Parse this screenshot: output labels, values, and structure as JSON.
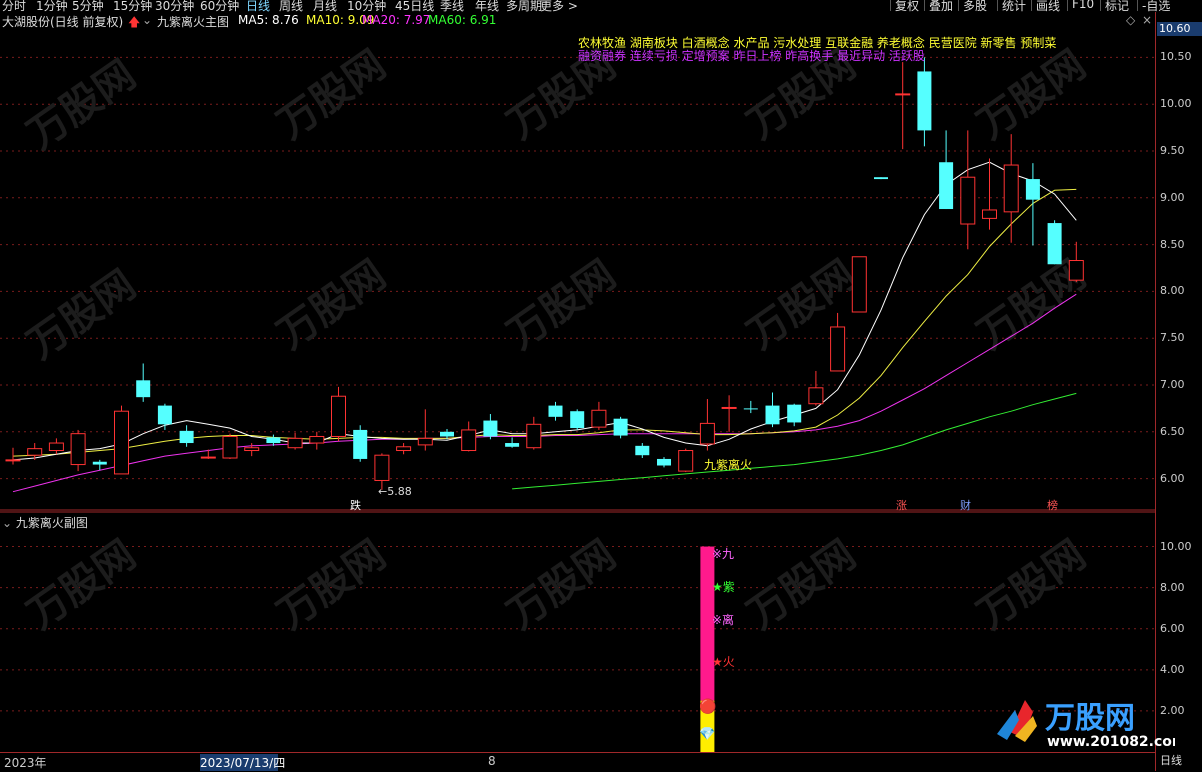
{
  "periods": [
    "分时",
    "1分钟",
    "5分钟",
    "15分钟",
    "30分钟",
    "60分钟",
    "日线",
    "周线",
    "月线",
    "10分钟",
    "45日线",
    "季线",
    "年线",
    "多周期",
    "更多 >"
  ],
  "active_period": "日线",
  "toolbar_right": [
    "复权",
    "叠加",
    "多股",
    "统计",
    "画线",
    "F10",
    "标记",
    "-自选"
  ],
  "stock_title": "大湖股份(日线 前复权)",
  "indicator_name": "九紫离火主图",
  "ma": [
    {
      "label": "MA5: 8.76",
      "color": "#ffffff"
    },
    {
      "label": "MA10: 9.09",
      "color": "#ffff33"
    },
    {
      "label": "MA20: 7.97",
      "color": "#ff33ff"
    },
    {
      "label": "MA60: 6.91",
      "color": "#33ff33"
    }
  ],
  "concepts_line1": "农林牧渔  湖南板块  白酒概念 水产品 污水处理 互联金融 养老概念 民营医院 新零售 预制菜",
  "concepts_line2": "融资融券 连续亏损 定增预案 昨日上榜 昨高换手 最近异动 活跃股",
  "current_price": "10.60",
  "price_ticks": [
    "10.50",
    "10.00",
    "9.50",
    "9.00",
    "8.50",
    "8.00",
    "7.50",
    "7.00",
    "6.50",
    "6.00"
  ],
  "sub_ticks": [
    "10.00",
    "8.00",
    "6.00",
    "4.00",
    "2.00"
  ],
  "low_label": "←5.88",
  "signal_label": "九紫离火",
  "markers": [
    {
      "text": "跌",
      "color": "#ffffff"
    },
    {
      "text": "涨",
      "color": "#ff5555"
    },
    {
      "text": "财",
      "color": "#7f9fff"
    },
    {
      "text": "榜",
      "color": "#ff5555"
    }
  ],
  "sub_panel_title": "九紫离火副图",
  "sub_signals": [
    {
      "text": "※九",
      "color": "#ff66ff"
    },
    {
      "text": "★紫",
      "color": "#33ff33"
    },
    {
      "text": "※离",
      "color": "#ff66ff"
    },
    {
      "text": "★火",
      "color": "#ff3333"
    }
  ],
  "bottom_year": "2023年",
  "bottom_date": "2023/07/13/四",
  "bottom_month": "8",
  "bottom_right": "日线",
  "watermark_brand": "万股网",
  "watermark_url": "www.201082.com",
  "chart_data": {
    "type": "candlestick",
    "ylim": [
      5.75,
      10.75
    ],
    "candles": [
      {
        "o": 6.19,
        "h": 6.33,
        "l": 6.15,
        "c": 6.2
      },
      {
        "o": 6.25,
        "h": 6.38,
        "l": 6.2,
        "c": 6.32
      },
      {
        "o": 6.3,
        "h": 6.43,
        "l": 6.26,
        "c": 6.38
      },
      {
        "o": 6.15,
        "h": 6.52,
        "l": 6.08,
        "c": 6.48
      },
      {
        "o": 6.18,
        "h": 6.2,
        "l": 6.09,
        "c": 6.15
      },
      {
        "o": 6.05,
        "h": 6.78,
        "l": 6.05,
        "c": 6.72
      },
      {
        "o": 7.05,
        "h": 7.23,
        "l": 6.82,
        "c": 6.87
      },
      {
        "o": 6.78,
        "h": 6.8,
        "l": 6.52,
        "c": 6.58
      },
      {
        "o": 6.51,
        "h": 6.57,
        "l": 6.34,
        "c": 6.38
      },
      {
        "o": 6.22,
        "h": 6.31,
        "l": 6.21,
        "c": 6.23
      },
      {
        "o": 6.22,
        "h": 6.48,
        "l": 6.21,
        "c": 6.45
      },
      {
        "o": 6.3,
        "h": 6.38,
        "l": 6.24,
        "c": 6.33
      },
      {
        "o": 6.44,
        "h": 6.47,
        "l": 6.35,
        "c": 6.38
      },
      {
        "o": 6.33,
        "h": 6.49,
        "l": 6.31,
        "c": 6.43
      },
      {
        "o": 6.38,
        "h": 6.5,
        "l": 6.31,
        "c": 6.45
      },
      {
        "o": 6.45,
        "h": 6.98,
        "l": 6.4,
        "c": 6.88
      },
      {
        "o": 6.52,
        "h": 6.57,
        "l": 6.18,
        "c": 6.21
      },
      {
        "o": 5.98,
        "h": 6.27,
        "l": 5.88,
        "c": 6.25
      },
      {
        "o": 6.3,
        "h": 6.38,
        "l": 6.26,
        "c": 6.34
      },
      {
        "o": 6.36,
        "h": 6.74,
        "l": 6.3,
        "c": 6.43
      },
      {
        "o": 6.5,
        "h": 6.53,
        "l": 6.42,
        "c": 6.45
      },
      {
        "o": 6.3,
        "h": 6.61,
        "l": 6.29,
        "c": 6.52
      },
      {
        "o": 6.62,
        "h": 6.69,
        "l": 6.42,
        "c": 6.45
      },
      {
        "o": 6.38,
        "h": 6.44,
        "l": 6.33,
        "c": 6.34
      },
      {
        "o": 6.33,
        "h": 6.66,
        "l": 6.31,
        "c": 6.58
      },
      {
        "o": 6.78,
        "h": 6.82,
        "l": 6.62,
        "c": 6.66
      },
      {
        "o": 6.72,
        "h": 6.74,
        "l": 6.52,
        "c": 6.54
      },
      {
        "o": 6.55,
        "h": 6.82,
        "l": 6.52,
        "c": 6.73
      },
      {
        "o": 6.64,
        "h": 6.66,
        "l": 6.43,
        "c": 6.46
      },
      {
        "o": 6.35,
        "h": 6.38,
        "l": 6.22,
        "c": 6.25
      },
      {
        "o": 6.21,
        "h": 6.23,
        "l": 6.12,
        "c": 6.14
      },
      {
        "o": 6.08,
        "h": 6.32,
        "l": 6.07,
        "c": 6.3
      },
      {
        "o": 6.37,
        "h": 6.85,
        "l": 6.3,
        "c": 6.59
      },
      {
        "o": 6.76,
        "h": 6.89,
        "l": 6.5,
        "c": 6.76
      },
      {
        "o": 6.75,
        "h": 6.83,
        "l": 6.7,
        "c": 6.74
      },
      {
        "o": 6.78,
        "h": 6.92,
        "l": 6.55,
        "c": 6.58
      },
      {
        "o": 6.79,
        "h": 6.8,
        "l": 6.56,
        "c": 6.6
      },
      {
        "o": 6.8,
        "h": 7.15,
        "l": 6.78,
        "c": 6.97
      },
      {
        "o": 7.15,
        "h": 7.77,
        "l": 7.15,
        "c": 7.62
      },
      {
        "o": 7.78,
        "h": 8.37,
        "l": 7.78,
        "c": 8.37
      },
      {
        "o": 9.22,
        "h": 9.22,
        "l": 9.2,
        "c": 9.2
      },
      {
        "o": 10.11,
        "h": 10.45,
        "l": 9.52,
        "c": 10.11
      },
      {
        "o": 10.35,
        "h": 10.5,
        "l": 9.55,
        "c": 9.72
      },
      {
        "o": 9.38,
        "h": 9.72,
        "l": 8.88,
        "c": 8.88
      },
      {
        "o": 8.72,
        "h": 9.72,
        "l": 8.45,
        "c": 9.22
      },
      {
        "o": 8.78,
        "h": 9.42,
        "l": 8.66,
        "c": 8.87
      },
      {
        "o": 8.85,
        "h": 9.68,
        "l": 8.52,
        "c": 9.35
      },
      {
        "o": 9.2,
        "h": 9.37,
        "l": 8.49,
        "c": 8.98
      },
      {
        "o": 8.73,
        "h": 8.76,
        "l": 8.29,
        "c": 8.29
      },
      {
        "o": 8.12,
        "h": 8.53,
        "l": 8.1,
        "c": 8.33
      }
    ],
    "ma5": [
      6.2,
      6.22,
      6.26,
      6.3,
      6.32,
      6.37,
      6.48,
      6.57,
      6.62,
      6.58,
      6.54,
      6.45,
      6.42,
      6.38,
      6.38,
      6.48,
      6.45,
      6.43,
      6.42,
      6.42,
      6.41,
      6.46,
      6.52,
      6.48,
      6.48,
      6.5,
      6.52,
      6.56,
      6.6,
      6.53,
      6.44,
      6.38,
      6.35,
      6.42,
      6.53,
      6.61,
      6.68,
      6.75,
      6.95,
      7.32,
      7.8,
      8.36,
      8.82,
      9.14,
      9.3,
      9.38,
      9.26,
      9.18,
      9.04,
      8.76
    ],
    "ma10": [
      6.24,
      6.25,
      6.26,
      6.28,
      6.3,
      6.32,
      6.36,
      6.4,
      6.43,
      6.45,
      6.46,
      6.46,
      6.44,
      6.43,
      6.42,
      6.43,
      6.44,
      6.44,
      6.43,
      6.43,
      6.43,
      6.45,
      6.47,
      6.46,
      6.46,
      6.47,
      6.47,
      6.49,
      6.52,
      6.52,
      6.51,
      6.49,
      6.47,
      6.47,
      6.48,
      6.49,
      6.51,
      6.55,
      6.68,
      6.86,
      7.1,
      7.4,
      7.68,
      7.95,
      8.18,
      8.48,
      8.72,
      8.94,
      9.08,
      9.09
    ],
    "ma20": [
      5.86,
      5.92,
      5.98,
      6.04,
      6.09,
      6.14,
      6.19,
      6.24,
      6.27,
      6.3,
      6.33,
      6.35,
      6.36,
      6.37,
      6.38,
      6.4,
      6.41,
      6.42,
      6.42,
      6.43,
      6.43,
      6.44,
      6.45,
      6.45,
      6.45,
      6.46,
      6.46,
      6.47,
      6.48,
      6.48,
      6.48,
      6.48,
      6.48,
      6.48,
      6.48,
      6.49,
      6.5,
      6.52,
      6.56,
      6.62,
      6.72,
      6.84,
      6.96,
      7.1,
      7.24,
      7.38,
      7.52,
      7.66,
      7.82,
      7.97
    ],
    "ma60": [
      null,
      null,
      null,
      null,
      null,
      null,
      null,
      null,
      null,
      null,
      null,
      null,
      null,
      null,
      null,
      null,
      null,
      null,
      null,
      null,
      null,
      null,
      null,
      5.89,
      5.91,
      5.93,
      5.95,
      5.97,
      5.99,
      6.01,
      6.03,
      6.05,
      6.07,
      6.09,
      6.11,
      6.13,
      6.15,
      6.18,
      6.21,
      6.25,
      6.3,
      6.36,
      6.44,
      6.52,
      6.59,
      6.66,
      6.72,
      6.79,
      6.85,
      6.91
    ]
  },
  "sub_chart": {
    "bar_top": 10.0,
    "bar_mid": 2.5,
    "bar_bottom": 0.0,
    "ylim": [
      0,
      11
    ]
  }
}
